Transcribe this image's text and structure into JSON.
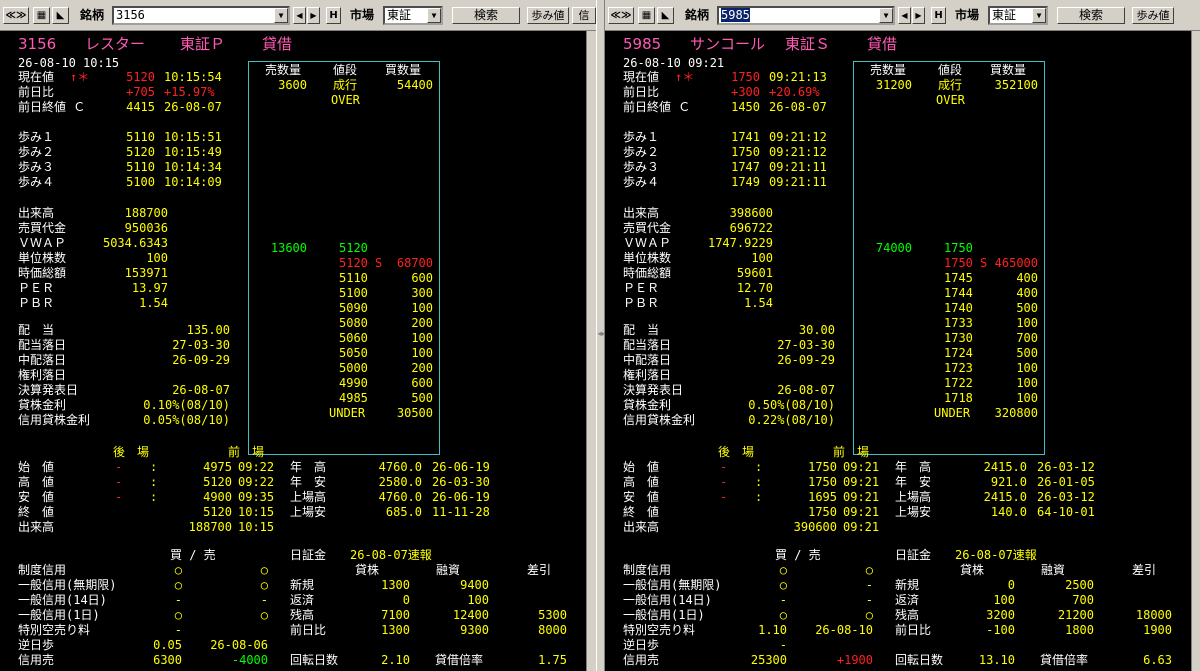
{
  "colors": {
    "background": "#000000",
    "label": "#ffffff",
    "value": "#ffff00",
    "up": "#ff2020",
    "board_buy": "#00ff00",
    "title": "#ff5ab4",
    "board_border": "#40c0c0"
  },
  "toolbar_icons": {
    "nav": "double-chevron-icon",
    "chart": "chart-icon",
    "pin": "pin-icon"
  },
  "panes": [
    {
      "toolbar": {
        "meigara_label": "銘柄",
        "code": "3156",
        "h_button": "H",
        "market_label": "市場",
        "market": "東証",
        "search": "検索",
        "ayumi": "歩み値",
        "extra": "信"
      },
      "header": {
        "code": "3156",
        "name": "レスター",
        "market": "東証Ｐ",
        "type": "貸借"
      },
      "datetime": "26-08-10 10:15",
      "current": {
        "label": "現在値",
        "mark": "↑＊",
        "value": "5120",
        "time": "10:15:54"
      },
      "change": {
        "label": "前日比",
        "value": "+705",
        "pct": "+15.97%"
      },
      "prev_close": {
        "label": "前日終値 Ｃ",
        "value": "4415",
        "date": "26-08-07"
      },
      "ayumi": [
        {
          "label": "歩み１",
          "price": "5110",
          "time": "10:15:51"
        },
        {
          "label": "歩み２",
          "price": "5120",
          "time": "10:15:49"
        },
        {
          "label": "歩み３",
          "price": "5110",
          "time": "10:14:34"
        },
        {
          "label": "歩み４",
          "price": "5100",
          "time": "10:14:09"
        }
      ],
      "stats": [
        {
          "label": "出来高",
          "value": "188700"
        },
        {
          "label": "売買代金",
          "value": "950036"
        },
        {
          "label": "ＶＷＡＰ",
          "value": "5034.6343"
        },
        {
          "label": "単位株数",
          "value": "100"
        },
        {
          "label": "時価総額",
          "value": "153971"
        },
        {
          "label": "ＰＥＲ",
          "value": "13.97"
        },
        {
          "label": "ＰＢＲ",
          "value": "1.54"
        }
      ],
      "dividend": [
        {
          "label": "配　当",
          "value": "135.00"
        },
        {
          "label": "配当落日",
          "value": "27-03-30"
        },
        {
          "label": "中配落日",
          "value": "26-09-29"
        },
        {
          "label": "権利落日",
          "value": ""
        },
        {
          "label": "決算発表日",
          "value": "26-08-07"
        },
        {
          "label": "貸株金利",
          "value": "0.10%(08/10)"
        },
        {
          "label": "信用貸株金利",
          "value": "0.05%(08/10)"
        }
      ],
      "board": {
        "headers": {
          "sell": "売数量",
          "price": "値段",
          "buy": "買数量"
        },
        "market_order": {
          "sell": "3600",
          "price": "成行",
          "buy": "54400"
        },
        "over": "OVER",
        "under": "UNDER",
        "under_qty": "30500",
        "top": {
          "sell": "13600",
          "price": "5120"
        },
        "current": {
          "price": "5120",
          "mark": "S",
          "qty": "68700"
        },
        "bids": [
          {
            "price": "5110",
            "qty": "600"
          },
          {
            "price": "5100",
            "qty": "300"
          },
          {
            "price": "5090",
            "qty": "100"
          },
          {
            "price": "5080",
            "qty": "200"
          },
          {
            "price": "5060",
            "qty": "100"
          },
          {
            "price": "5050",
            "qty": "100"
          },
          {
            "price": "5000",
            "qty": "200"
          },
          {
            "price": "4990",
            "qty": "600"
          },
          {
            "price": "4985",
            "qty": "500"
          }
        ]
      },
      "session": {
        "header_after": "後　場",
        "header_before": "前　場",
        "rows": [
          {
            "label": "始　値",
            "a1": "-",
            "a2": ":",
            "p": "4975",
            "t": "09:22",
            "l2": "年　高",
            "v2": "4760.0",
            "d2": "26-06-19"
          },
          {
            "label": "高　値",
            "a1": "-",
            "a2": ":",
            "p": "5120",
            "t": "09:22",
            "l2": "年　安",
            "v2": "2580.0",
            "d2": "26-03-30"
          },
          {
            "label": "安　値",
            "a1": "-",
            "a2": ":",
            "p": "4900",
            "t": "09:35",
            "l2": "上場高",
            "v2": "4760.0",
            "d2": "26-06-19"
          },
          {
            "label": "終　値",
            "a1": "",
            "a2": "",
            "p": "5120",
            "t": "10:15",
            "l2": "上場安",
            "v2": "685.0",
            "d2": "11-11-28"
          },
          {
            "label": "出来高",
            "a1": "",
            "a2": "",
            "p": "188700",
            "t": "10:15",
            "l2": "",
            "v2": "",
            "d2": ""
          }
        ]
      },
      "credit": {
        "header": "買 / 売",
        "nissho_label": "日証金",
        "nissho_date": "26-08-07速報",
        "cols": {
          "kashikabu": "貸株",
          "yushi": "融資",
          "sashihiki": "差引"
        },
        "rows": [
          {
            "label": "制度信用",
            "buy": "○",
            "sell": "○",
            "l2": "",
            "v1": "",
            "v2": "",
            "v3": ""
          },
          {
            "label": "一般信用(無期限)",
            "buy": "○",
            "sell": "○",
            "l2": "新規",
            "v1": "1300",
            "v2": "9400",
            "v3": ""
          },
          {
            "label": "一般信用(14日)",
            "buy": "-",
            "sell": "-",
            "l2": "返済",
            "v1": "0",
            "v2": "100",
            "v3": ""
          },
          {
            "label": "一般信用(1日)",
            "buy": "○",
            "sell": "○",
            "l2": "残高",
            "v1": "7100",
            "v2": "12400",
            "v3": "5300"
          },
          {
            "label": "特別空売り料",
            "buy": "-",
            "sell": "",
            "l2": "前日比",
            "v1": "1300",
            "v2": "9300",
            "v3": "8000"
          },
          {
            "label": "逆日歩",
            "buy": "0.05",
            "sell": "26-08-06",
            "l2": "",
            "v1": "",
            "v2": "",
            "v3": ""
          },
          {
            "label": "信用売",
            "buy": "6300",
            "sell": "-4000",
            "l2": "回転日数",
            "v1": "2.10",
            "v2": "貸借倍率",
            "v3": "1.75"
          }
        ]
      }
    },
    {
      "toolbar": {
        "meigara_label": "銘柄",
        "code": "5985",
        "h_button": "H",
        "market_label": "市場",
        "market": "東証",
        "search": "検索",
        "ayumi": "歩み値"
      },
      "header": {
        "code": "5985",
        "name": "サンコール",
        "market": "東証Ｓ",
        "type": "貸借"
      },
      "datetime": "26-08-10 09:21",
      "current": {
        "label": "現在値",
        "mark": "↑＊",
        "value": "1750",
        "time": "09:21:13"
      },
      "change": {
        "label": "前日比",
        "value": "+300",
        "pct": "+20.69%"
      },
      "prev_close": {
        "label": "前日終値 Ｃ",
        "value": "1450",
        "date": "26-08-07"
      },
      "ayumi": [
        {
          "label": "歩み１",
          "price": "1741",
          "time": "09:21:12"
        },
        {
          "label": "歩み２",
          "price": "1750",
          "time": "09:21:12"
        },
        {
          "label": "歩み３",
          "price": "1747",
          "time": "09:21:11"
        },
        {
          "label": "歩み４",
          "price": "1749",
          "time": "09:21:11"
        }
      ],
      "stats": [
        {
          "label": "出来高",
          "value": "398600"
        },
        {
          "label": "売買代金",
          "value": "696722"
        },
        {
          "label": "ＶＷＡＰ",
          "value": "1747.9229"
        },
        {
          "label": "単位株数",
          "value": "100"
        },
        {
          "label": "時価総額",
          "value": "59601"
        },
        {
          "label": "ＰＥＲ",
          "value": "12.70"
        },
        {
          "label": "ＰＢＲ",
          "value": "1.54"
        }
      ],
      "dividend": [
        {
          "label": "配　当",
          "value": "30.00"
        },
        {
          "label": "配当落日",
          "value": "27-03-30"
        },
        {
          "label": "中配落日",
          "value": "26-09-29"
        },
        {
          "label": "権利落日",
          "value": ""
        },
        {
          "label": "決算発表日",
          "value": "26-08-07"
        },
        {
          "label": "貸株金利",
          "value": "0.50%(08/10)"
        },
        {
          "label": "信用貸株金利",
          "value": "0.22%(08/10)"
        }
      ],
      "board": {
        "headers": {
          "sell": "売数量",
          "price": "値段",
          "buy": "買数量"
        },
        "market_order": {
          "sell": "31200",
          "price": "成行",
          "buy": "352100"
        },
        "over": "OVER",
        "under": "UNDER",
        "under_qty": "320800",
        "top": {
          "sell": "74000",
          "price": "1750"
        },
        "current": {
          "price": "1750",
          "mark": "S",
          "qty": "465000"
        },
        "bids": [
          {
            "price": "1745",
            "qty": "400"
          },
          {
            "price": "1744",
            "qty": "400"
          },
          {
            "price": "1740",
            "qty": "500"
          },
          {
            "price": "1733",
            "qty": "100"
          },
          {
            "price": "1730",
            "qty": "700"
          },
          {
            "price": "1724",
            "qty": "500"
          },
          {
            "price": "1723",
            "qty": "100"
          },
          {
            "price": "1722",
            "qty": "100"
          },
          {
            "price": "1718",
            "qty": "100"
          }
        ]
      },
      "session": {
        "header_after": "後　場",
        "header_before": "前　場",
        "rows": [
          {
            "label": "始　値",
            "a1": "-",
            "a2": ":",
            "p": "1750",
            "t": "09:21",
            "l2": "年　高",
            "v2": "2415.0",
            "d2": "26-03-12"
          },
          {
            "label": "高　値",
            "a1": "-",
            "a2": ":",
            "p": "1750",
            "t": "09:21",
            "l2": "年　安",
            "v2": "921.0",
            "d2": "26-01-05"
          },
          {
            "label": "安　値",
            "a1": "-",
            "a2": ":",
            "p": "1695",
            "t": "09:21",
            "l2": "上場高",
            "v2": "2415.0",
            "d2": "26-03-12"
          },
          {
            "label": "終　値",
            "a1": "",
            "a2": "",
            "p": "1750",
            "t": "09:21",
            "l2": "上場安",
            "v2": "140.0",
            "d2": "64-10-01"
          },
          {
            "label": "出来高",
            "a1": "",
            "a2": "",
            "p": "390600",
            "t": "09:21",
            "l2": "",
            "v2": "",
            "d2": ""
          }
        ]
      },
      "credit": {
        "header": "買 / 売",
        "nissho_label": "日証金",
        "nissho_date": "26-08-07速報",
        "cols": {
          "kashikabu": "貸株",
          "yushi": "融資",
          "sashihiki": "差引"
        },
        "rows": [
          {
            "label": "制度信用",
            "buy": "○",
            "sell": "○",
            "l2": "",
            "v1": "",
            "v2": "",
            "v3": ""
          },
          {
            "label": "一般信用(無期限)",
            "buy": "○",
            "sell": "-",
            "l2": "新規",
            "v1": "0",
            "v2": "2500",
            "v3": ""
          },
          {
            "label": "一般信用(14日)",
            "buy": "-",
            "sell": "-",
            "l2": "返済",
            "v1": "100",
            "v2": "700",
            "v3": ""
          },
          {
            "label": "一般信用(1日)",
            "buy": "○",
            "sell": "○",
            "l2": "残高",
            "v1": "3200",
            "v2": "21200",
            "v3": "18000"
          },
          {
            "label": "特別空売り料",
            "buy": "1.10",
            "sell": "26-08-10",
            "l2": "前日比",
            "v1": "-100",
            "v2": "1800",
            "v3": "1900"
          },
          {
            "label": "逆日歩",
            "buy": "-",
            "sell": "",
            "l2": "",
            "v1": "",
            "v2": "",
            "v3": ""
          },
          {
            "label": "信用売",
            "buy": "25300",
            "sell": "+1900",
            "l2": "回転日数",
            "v1": "13.10",
            "v2": "貸借倍率",
            "v3": "6.63"
          }
        ]
      }
    }
  ]
}
